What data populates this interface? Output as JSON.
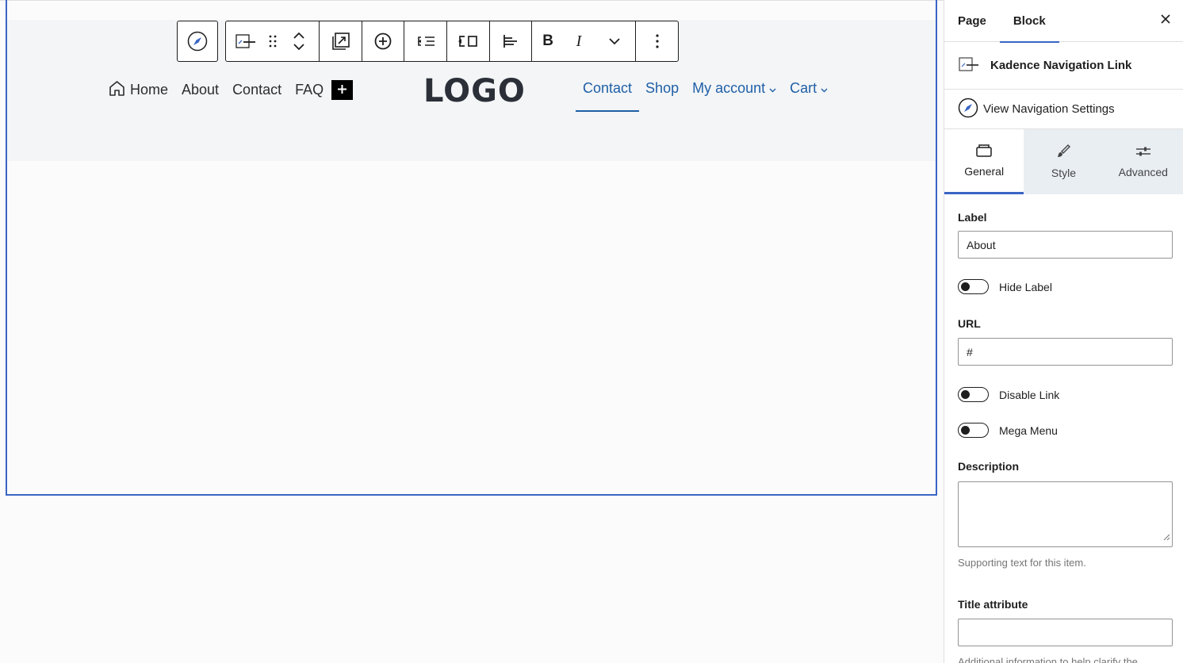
{
  "toolbar": {
    "buttons": [
      "navigation-icon",
      "block-type-icon",
      "drag-handle-icon",
      "move-up-icon",
      "move-down-icon",
      "replace-icon",
      "add-submenu-icon",
      "convert-to-submenu-icon",
      "link-settings-icon",
      "align-icon",
      "bold-icon",
      "italic-icon",
      "more-rich-text-icon",
      "options-icon"
    ]
  },
  "nav": {
    "left_items": [
      "Home",
      "About",
      "Contact",
      "FAQ"
    ],
    "add_label": "+",
    "logo": "LOGO",
    "right_items": [
      {
        "label": "Contact",
        "has_submenu": false,
        "active": true
      },
      {
        "label": "Shop",
        "has_submenu": false,
        "active": false
      },
      {
        "label": "My account",
        "has_submenu": true,
        "active": false
      },
      {
        "label": "Cart",
        "has_submenu": true,
        "active": false
      }
    ],
    "text_color": "#2d2d2d",
    "link_color": "#1f5fa6"
  },
  "sidebar": {
    "tabs": [
      {
        "label": "Page",
        "active": false
      },
      {
        "label": "Block",
        "active": true
      }
    ],
    "close_icon": "close-icon",
    "block_title": "Kadence Navigation Link",
    "view_nav_label": "View Navigation Settings",
    "kt_tabs": [
      {
        "label": "General",
        "icon": "general-icon",
        "active": true
      },
      {
        "label": "Style",
        "icon": "brush-icon",
        "active": false
      },
      {
        "label": "Advanced",
        "icon": "sliders-icon",
        "active": false
      }
    ],
    "fields": {
      "label_title": "Label",
      "label_value": "About",
      "hide_label": "Hide Label",
      "url_title": "URL",
      "url_value": "#",
      "disable_link": "Disable Link",
      "mega_menu": "Mega Menu",
      "description_title": "Description",
      "description_help": "Supporting text for this item.",
      "title_attr_title": "Title attribute",
      "title_attr_help": "Additional information to help clarify the"
    },
    "accent_color": "#3a65c4"
  }
}
